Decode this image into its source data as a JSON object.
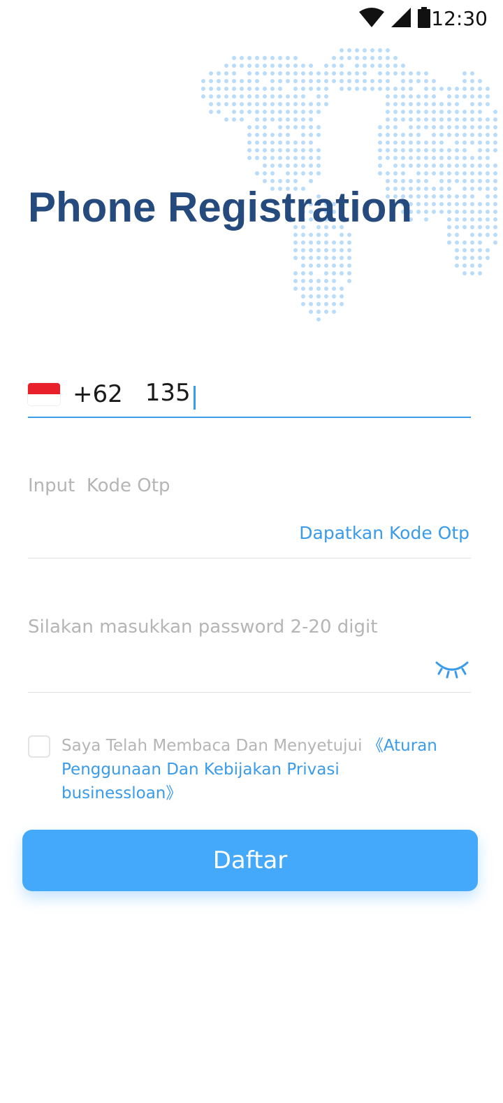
{
  "status_bar": {
    "time": "12:30",
    "icons": [
      "wifi-icon",
      "signal-icon",
      "battery-icon"
    ]
  },
  "page": {
    "title": "Phone Registration"
  },
  "phone": {
    "flag": "indonesia-flag",
    "country_code": "+62",
    "value": "135"
  },
  "otp": {
    "placeholder": "Input  Kode Otp",
    "get_code_label": "Dapatkan Kode Otp"
  },
  "password": {
    "placeholder": "Silakan masukkan password 2-20 digit",
    "toggle_icon": "eye-closed-icon"
  },
  "agreement": {
    "text": "Saya Telah Membaca Dan Menyetujui ",
    "link": "《Aturan Penggunaan Dan Kebijakan Privasi businessloan》",
    "checked": false
  },
  "submit": {
    "label": "Daftar"
  },
  "colors": {
    "title": "#254a7d",
    "accent": "#3a9bea",
    "button": "#44a9fa",
    "placeholder": "#b5b5b5",
    "map_dots": "#b9dcfa"
  }
}
